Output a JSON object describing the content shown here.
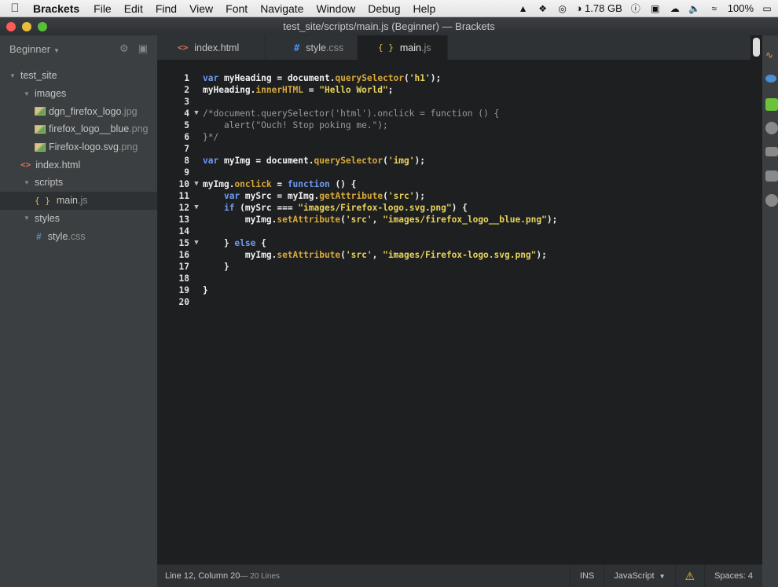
{
  "menubar": {
    "app_name": "Brackets",
    "items": [
      "File",
      "Edit",
      "Find",
      "View",
      "Font",
      "Navigate",
      "Window",
      "Debug",
      "Help"
    ],
    "memory": "1.78 GB",
    "battery": "100%"
  },
  "window": {
    "title": "test_site/scripts/main.js (Beginner) — Brackets"
  },
  "sidebar": {
    "project": "Beginner",
    "tree": [
      {
        "label": "test_site",
        "kind": "folder"
      },
      {
        "label": "images",
        "kind": "folder"
      },
      {
        "name": "dgn_firefox_logo",
        "ext": ".jpg",
        "kind": "image"
      },
      {
        "name": "firefox_logo__blue",
        "ext": ".png",
        "kind": "image"
      },
      {
        "name": "Firefox-logo.svg",
        "ext": ".png",
        "kind": "image"
      },
      {
        "name": "index",
        "ext": ".html",
        "kind": "html"
      },
      {
        "label": "scripts",
        "kind": "folder"
      },
      {
        "name": "main",
        "ext": ".js",
        "kind": "js"
      },
      {
        "label": "styles",
        "kind": "folder"
      },
      {
        "name": "style",
        "ext": ".css",
        "kind": "css"
      }
    ]
  },
  "tabs": [
    {
      "name": "index",
      "ext": ".html",
      "icon": "<>"
    },
    {
      "name": "style",
      "ext": ".css",
      "icon": "#"
    },
    {
      "name": "main",
      "ext": ".js",
      "icon": "{ }"
    }
  ],
  "editor": {
    "lines": [
      "var myHeading = document.querySelector('h1');",
      "myHeading.innerHTML = \"Hello World\";",
      "",
      "/*document.querySelector('html').onclick = function () {",
      "    alert(\"Ouch! Stop poking me.\");",
      "}*/",
      "",
      "var myImg = document.querySelector('img');",
      "",
      "myImg.onclick = function () {",
      "    var mySrc = myImg.getAttribute('src');",
      "    if (mySrc === \"images/Firefox-logo.svg.png\") {",
      "        myImg.setAttribute('src', \"images/firefox_logo__blue.png\");",
      "",
      "    } else {",
      "        myImg.setAttribute('src', \"images/Firefox-logo.svg.png\");",
      "    }",
      "",
      "}",
      ""
    ]
  },
  "status": {
    "cursor": "Line 12, Column 20",
    "lines": " — 20 Lines",
    "mode": "INS",
    "language": "JavaScript",
    "spaces": "Spaces: 4"
  }
}
